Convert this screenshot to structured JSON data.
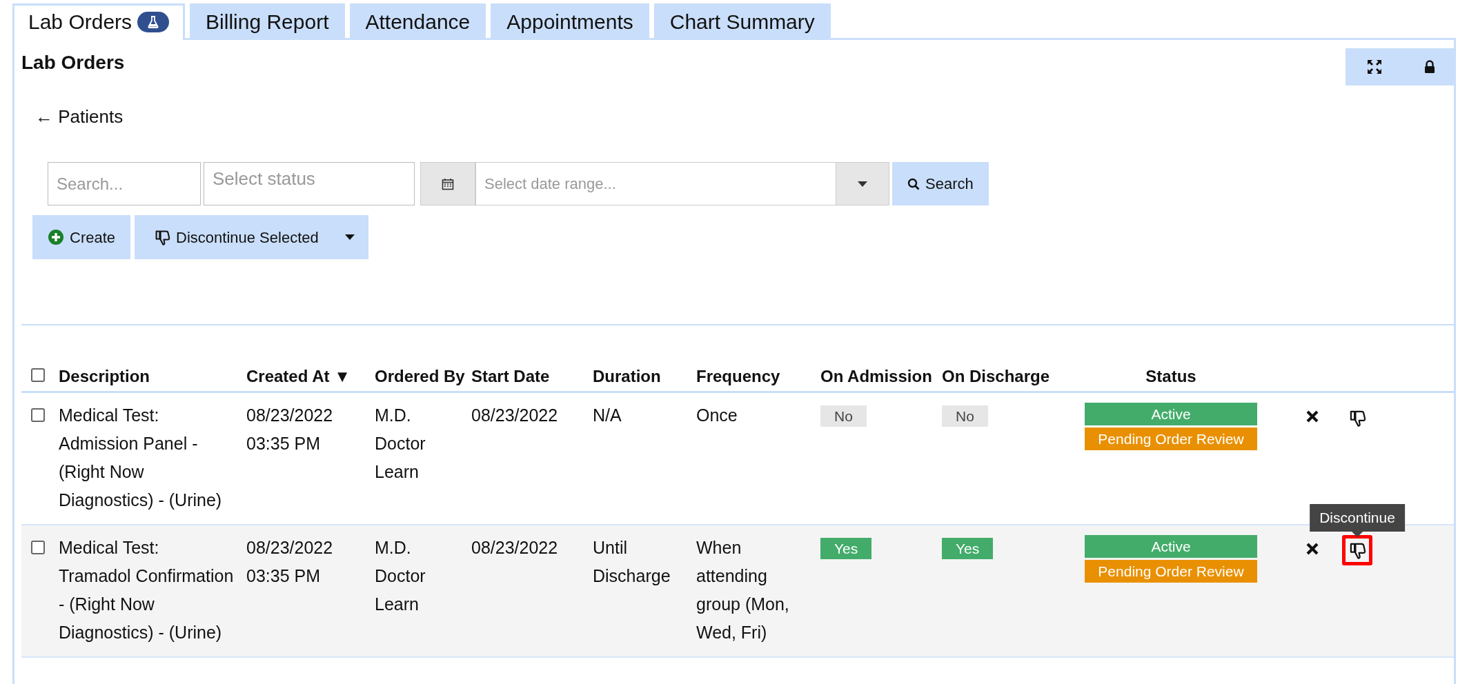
{
  "tabs": [
    {
      "label": "Lab Orders",
      "selected": true,
      "has_icon": true
    },
    {
      "label": "Billing Report",
      "selected": false
    },
    {
      "label": "Attendance",
      "selected": false
    },
    {
      "label": "Appointments",
      "selected": false
    },
    {
      "label": "Chart Summary",
      "selected": false
    }
  ],
  "panel": {
    "title": "Lab Orders",
    "back_link": "← Patients"
  },
  "filters": {
    "search": {
      "placeholder": "Search..."
    },
    "status": {
      "placeholder": "Select status"
    },
    "date_range": {
      "placeholder": "Select date range..."
    },
    "search_button": "Search"
  },
  "actions": {
    "create": "Create",
    "discontinue_selected": "Discontinue Selected"
  },
  "table": {
    "select_all_checked": false,
    "columns": [
      "Description",
      "Created At ▼",
      "Ordered By",
      "Start Date",
      "Duration",
      "Frequency",
      "On Admission",
      "On Discharge",
      "Status"
    ],
    "rows": [
      {
        "checked": false,
        "description": "Medical Test: Admission Panel - (Right Now Diagnostics) - (Urine)",
        "created_at": [
          "08/23/2022",
          "03:35 PM"
        ],
        "ordered_by": "M.D. Doctor Learn",
        "start_date": "08/23/2022",
        "duration": "N/A",
        "frequency": "Once",
        "on_admission": {
          "text": "No",
          "on": false
        },
        "on_discharge": {
          "text": "No",
          "on": false
        },
        "status": [
          {
            "text": "Active",
            "kind": "active"
          },
          {
            "text": "Pending Order Review",
            "kind": "pending"
          }
        ],
        "highlighted": false
      },
      {
        "checked": false,
        "description": "Medical Test: Tramadol Confirmation - (Right Now Diagnostics) - (Urine)",
        "created_at": [
          "08/23/2022",
          "03:35 PM"
        ],
        "ordered_by": "M.D. Doctor Learn",
        "start_date": "08/23/2022",
        "duration": "Until Discharge",
        "frequency": "When attending group (Mon, Wed, Fri)",
        "on_admission": {
          "text": "Yes",
          "on": true
        },
        "on_discharge": {
          "text": "Yes",
          "on": true
        },
        "status": [
          {
            "text": "Active",
            "kind": "active"
          },
          {
            "text": "Pending Order Review",
            "kind": "pending"
          }
        ],
        "highlighted": true,
        "tooltip": "Discontinue"
      }
    ]
  }
}
